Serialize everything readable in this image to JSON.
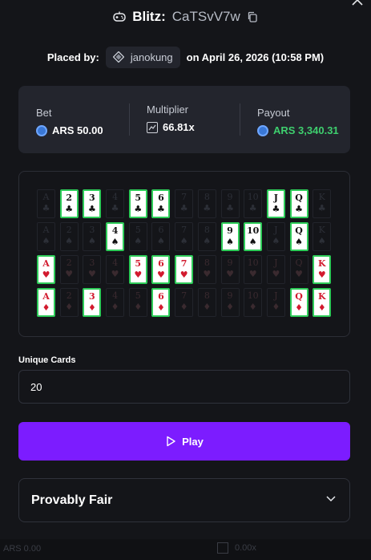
{
  "header": {
    "game_name": "Blitz:",
    "bet_id": "CaTSvV7w"
  },
  "placed": {
    "label": "Placed by:",
    "username": "janokung",
    "date_text": "on April 26, 2026 (10:58 PM)"
  },
  "stats": {
    "bet_label": "Bet",
    "bet_value": "ARS 50.00",
    "multiplier_label": "Multiplier",
    "multiplier_value": "66.81x",
    "payout_label": "Payout",
    "payout_value": "ARS 3,340.31",
    "payout_color": "#3ecf6e"
  },
  "board": {
    "ranks": [
      "A",
      "2",
      "3",
      "4",
      "5",
      "6",
      "7",
      "8",
      "9",
      "10",
      "J",
      "Q",
      "K"
    ],
    "rows": [
      {
        "suit": "♣",
        "color": "black",
        "selected": [
          "2",
          "3",
          "5",
          "6",
          "J",
          "Q"
        ]
      },
      {
        "suit": "♠",
        "color": "black",
        "selected": [
          "4",
          "9",
          "10",
          "Q"
        ]
      },
      {
        "suit": "♥",
        "color": "red",
        "selected": [
          "A",
          "5",
          "6",
          "7",
          "K"
        ]
      },
      {
        "suit": "♦",
        "color": "red",
        "selected": [
          "A",
          "3",
          "6",
          "Q",
          "K"
        ]
      }
    ],
    "selected_border_color": "#2ecc59"
  },
  "unique_cards": {
    "label": "Unique Cards",
    "value": "20"
  },
  "play_button": {
    "label": "Play",
    "color": "#7c1cff"
  },
  "provably_fair": {
    "title": "Provably Fair"
  },
  "footer_peek": {
    "left_text": "ARS 0.00",
    "right_text": "0.00x"
  }
}
